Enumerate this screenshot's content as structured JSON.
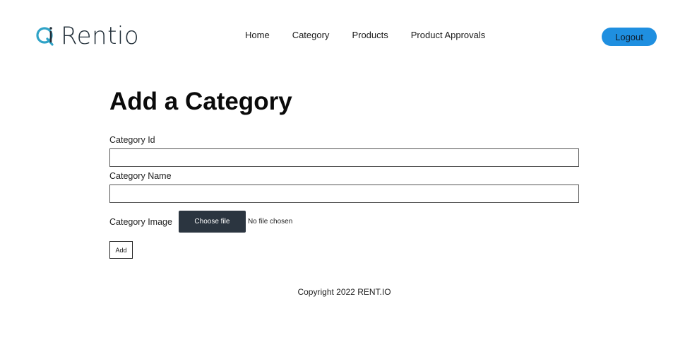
{
  "brand": {
    "name_first": "R",
    "name_rest": "entio",
    "logo_icon": "ri-monogram-icon",
    "accent_color": "#2fa3c7"
  },
  "nav": {
    "items": [
      {
        "label": "Home"
      },
      {
        "label": "Category"
      },
      {
        "label": "Products"
      },
      {
        "label": "Product Approvals"
      }
    ]
  },
  "header": {
    "logout_label": "Logout",
    "logout_color": "#1f8fe0"
  },
  "main": {
    "title": "Add a Category",
    "fields": {
      "category_id": {
        "label": "Category Id",
        "value": ""
      },
      "category_name": {
        "label": "Category Name",
        "value": ""
      },
      "category_image": {
        "label": "Category Image",
        "button_label": "Choose file",
        "status": "No file chosen"
      }
    },
    "submit_label": "Add"
  },
  "footer": {
    "copyright": "Copyright 2022 RENT.IO"
  }
}
